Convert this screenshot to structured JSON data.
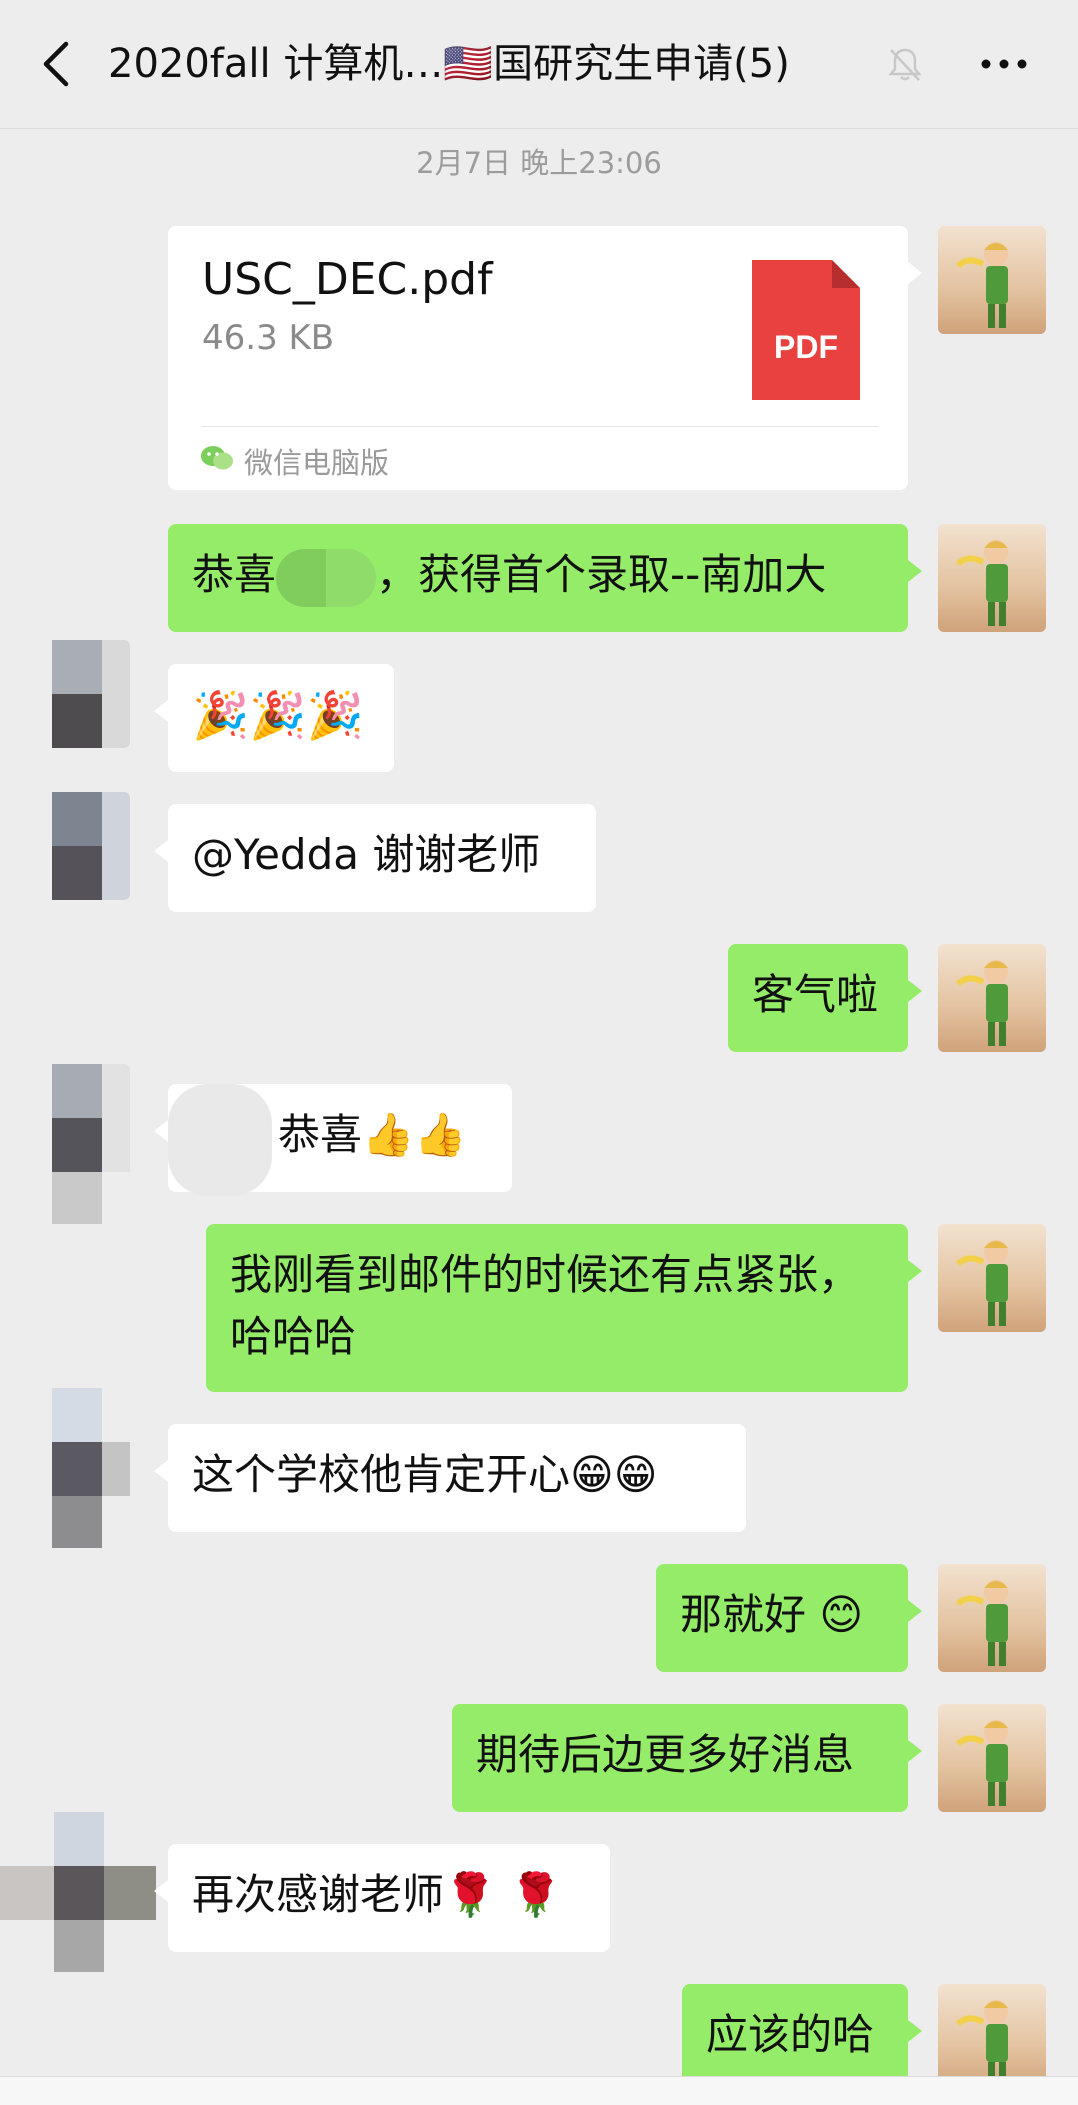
{
  "header": {
    "title": "2020fall 计算机…🇺🇸国研究生申请(5)"
  },
  "timestamp": "2月7日 晚上23:06",
  "file_message": {
    "file_name": "USC_DEC.pdf",
    "file_size": "46.3 KB",
    "file_type_label": "PDF",
    "source": "微信电脑版"
  },
  "messages": [
    {
      "side": "me",
      "text_before": "恭喜",
      "text_after": "，获得首个录取--南加大"
    },
    {
      "side": "other",
      "text": "🎉🎉🎉"
    },
    {
      "side": "other",
      "text": "@Yedda  谢谢老师"
    },
    {
      "side": "me",
      "text": "客气啦"
    },
    {
      "side": "other",
      "text": "恭喜👍👍"
    },
    {
      "side": "me",
      "text_line1": "我刚看到邮件的时候还有点紧张，",
      "text_line2": "哈哈哈"
    },
    {
      "side": "other",
      "text": "这个学校他肯定开心😁😁"
    },
    {
      "side": "me",
      "text": "那就好 😊"
    },
    {
      "side": "me",
      "text": "期待后边更多好消息"
    },
    {
      "side": "other",
      "text": "再次感谢老师🌹 🌹"
    },
    {
      "side": "me",
      "text": "应该的哈"
    }
  ],
  "colors": {
    "background": "#ededed",
    "my_bubble": "#95ec69",
    "other_bubble": "#ffffff",
    "pdf_red": "#e94040"
  }
}
